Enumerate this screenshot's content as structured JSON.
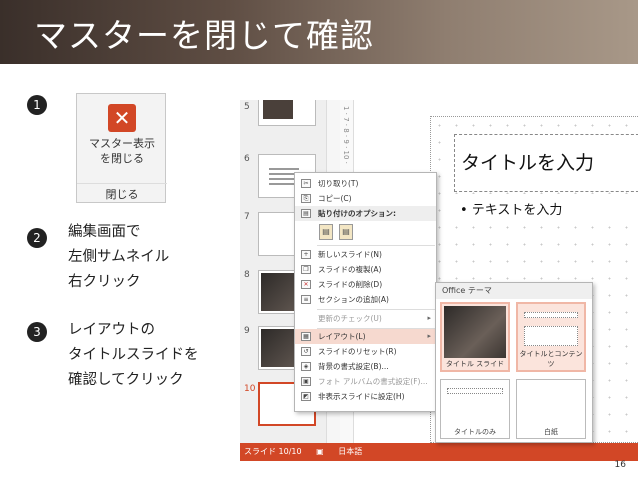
{
  "title": "マスターを閉じて確認",
  "page_number": "16",
  "steps": [
    {
      "num": "1",
      "text": ""
    },
    {
      "num": "2",
      "text": "編集画面で\n左側サムネイル\n右クリック"
    },
    {
      "num": "3",
      "text": "レイアウトの\nタイトルスライドを\n確認してクリック"
    }
  ],
  "ribbon": {
    "close_icon_glyph": "✕",
    "button_label": "マスター表示\nを閉じる",
    "group_label": "閉じる",
    "accent": "#d24726"
  },
  "thumbnails": [
    "5",
    "6",
    "7",
    "8",
    "9",
    "10"
  ],
  "ruler_marks": "1 · 7 · 8 · 9 · 10 ·",
  "slide": {
    "title_placeholder": "タイトルを入力",
    "body_placeholder": "• テキストを入力"
  },
  "status_bar": {
    "slide_info": "スライド 10/10",
    "language": "日本語",
    "color": "#d24726"
  },
  "context_menu": {
    "cut": "切り取り(T)",
    "copy": "コピー(C)",
    "paste_options": "貼り付けのオプション:",
    "new_slide": "新しいスライド(N)",
    "duplicate": "スライドの複製(A)",
    "delete": "スライドの削除(D)",
    "add_section": "セクションの追加(A)",
    "check_updates": "更新のチェック(U)",
    "layout": "レイアウト(L)",
    "reset": "スライドのリセット(R)",
    "format_background": "背景の書式設定(B)...",
    "photo_album": "フォト アルバムの書式設定(F)...",
    "hide_slide": "非表示スライドに設定(H)"
  },
  "layout_gallery": {
    "header": "Office テーマ",
    "items": [
      "タイトル スライド",
      "タイトルとコンテンツ",
      "タイトルのみ",
      "白紙"
    ]
  }
}
